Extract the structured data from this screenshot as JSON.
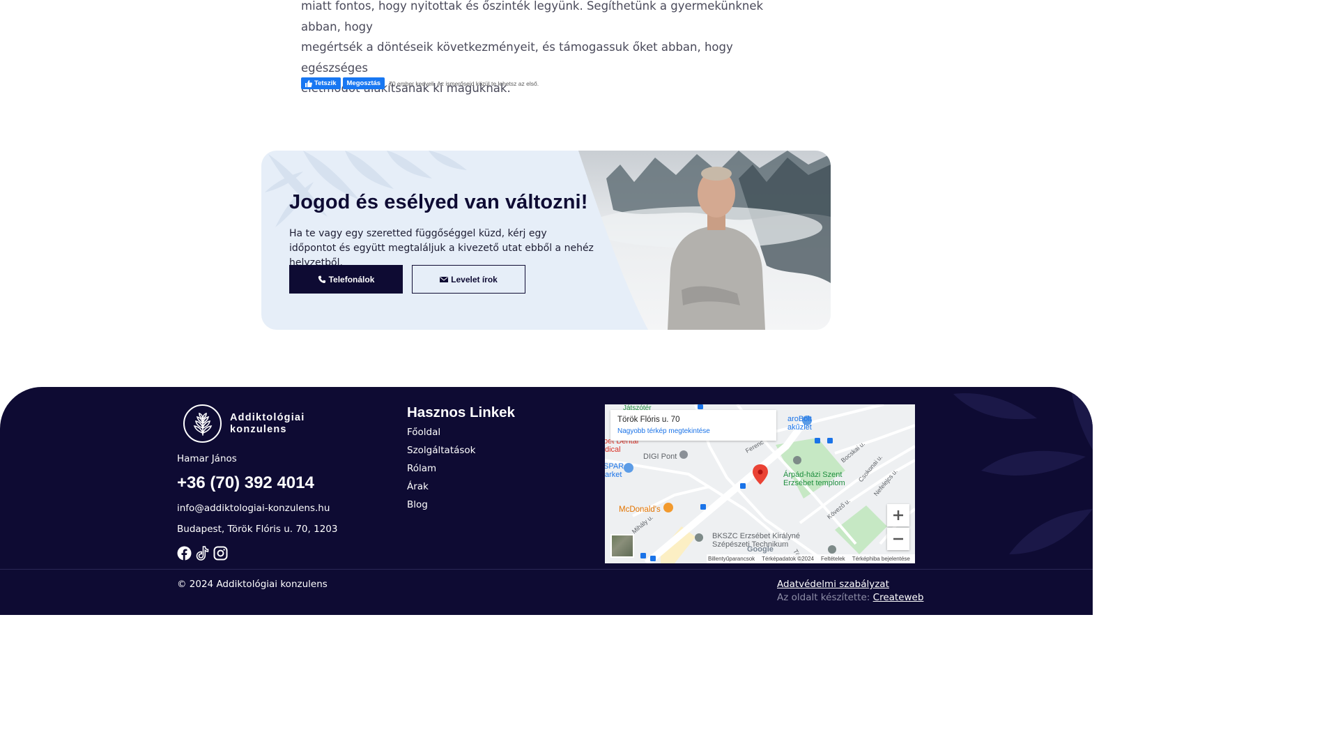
{
  "article": {
    "lines": [
      "miatt fontos, hogy nyitottak és őszinték legyünk. Segíthetünk a gyermekünknek abban, hogy",
      "megértsék a döntéseik következményeit, és támogassuk őket abban, hogy egészséges",
      "életmódot alakítsanak ki maguknak."
    ]
  },
  "facebook": {
    "like_label": "Tetszik",
    "share_label": "Megosztás",
    "likes_text": "70 ember kedveli. Az ismerőseid közül te lehetsz az első."
  },
  "cta": {
    "title": "Jogod és esélyed van változni!",
    "description": "Ha te vagy egy szeretted függőséggel küzd, kérj egy időpontot és együtt megtaláljuk a kivezető utat ebből a nehéz helyzetből.",
    "call_label": "Telefonálok",
    "mail_label": "Levelet írok"
  },
  "footer": {
    "logo_line1": "Addiktológiai",
    "logo_line2": "konzulens",
    "name": "Hamar János",
    "phone": "+36 (70) 392 4014",
    "email": "info@addiktologiai-konzulens.hu",
    "address": "Budapest, Török Flóris u. 70, 1203",
    "social_icons": [
      "facebook-icon",
      "tiktok-icon",
      "instagram-icon"
    ],
    "links_title": "Hasznos Linkek",
    "links": [
      "Főoldal",
      "Szolgáltatások",
      "Rólam",
      "Árak",
      "Blog"
    ],
    "copyright": "© 2024 Addiktológiai konzulens",
    "privacy": "Adatvédelmi szabályzat",
    "credit_prefix": "Az oldalt készítette:",
    "credit_link": "Createweb"
  },
  "map": {
    "place_title": "Török Flóris u. 70",
    "larger_map": "Nagyobb térkép megtekintése",
    "labels": {
      "digi": "DIGI Pont",
      "mcdonalds": "McDonald's",
      "church1": "Árpád-házi Szent",
      "church2": "Erzsébet templom",
      "school1": "BKSZC Erzsébet Királyné",
      "school2": "Szépészeti Technikum",
      "spar1": "SPAR",
      "spar2": "arket",
      "dental1": "bet Dental",
      "dental2": "dical",
      "jatszoter": "Játszótér",
      "arobolt1": "aroBolt",
      "arobolt2": "akűzlet",
      "street1": "Török Flóris u.",
      "street2": "Ferenc",
      "street3": "Bocskai u.",
      "street4": "Csokonai u.",
      "street5": "Nefelejcs u.",
      "street6": "Kövező u.",
      "street7": "Mihály u."
    },
    "footer_items": [
      "Billentyűparancsok",
      "Térképadatok ©2024",
      "Feltételek",
      "Térképhiba bejelentése"
    ],
    "google": "Google"
  },
  "colors": {
    "navy": "#0e0b33",
    "card_bg": "#e6eef8",
    "facebook_blue": "#1877f2",
    "map_pin": "#ea4335"
  }
}
